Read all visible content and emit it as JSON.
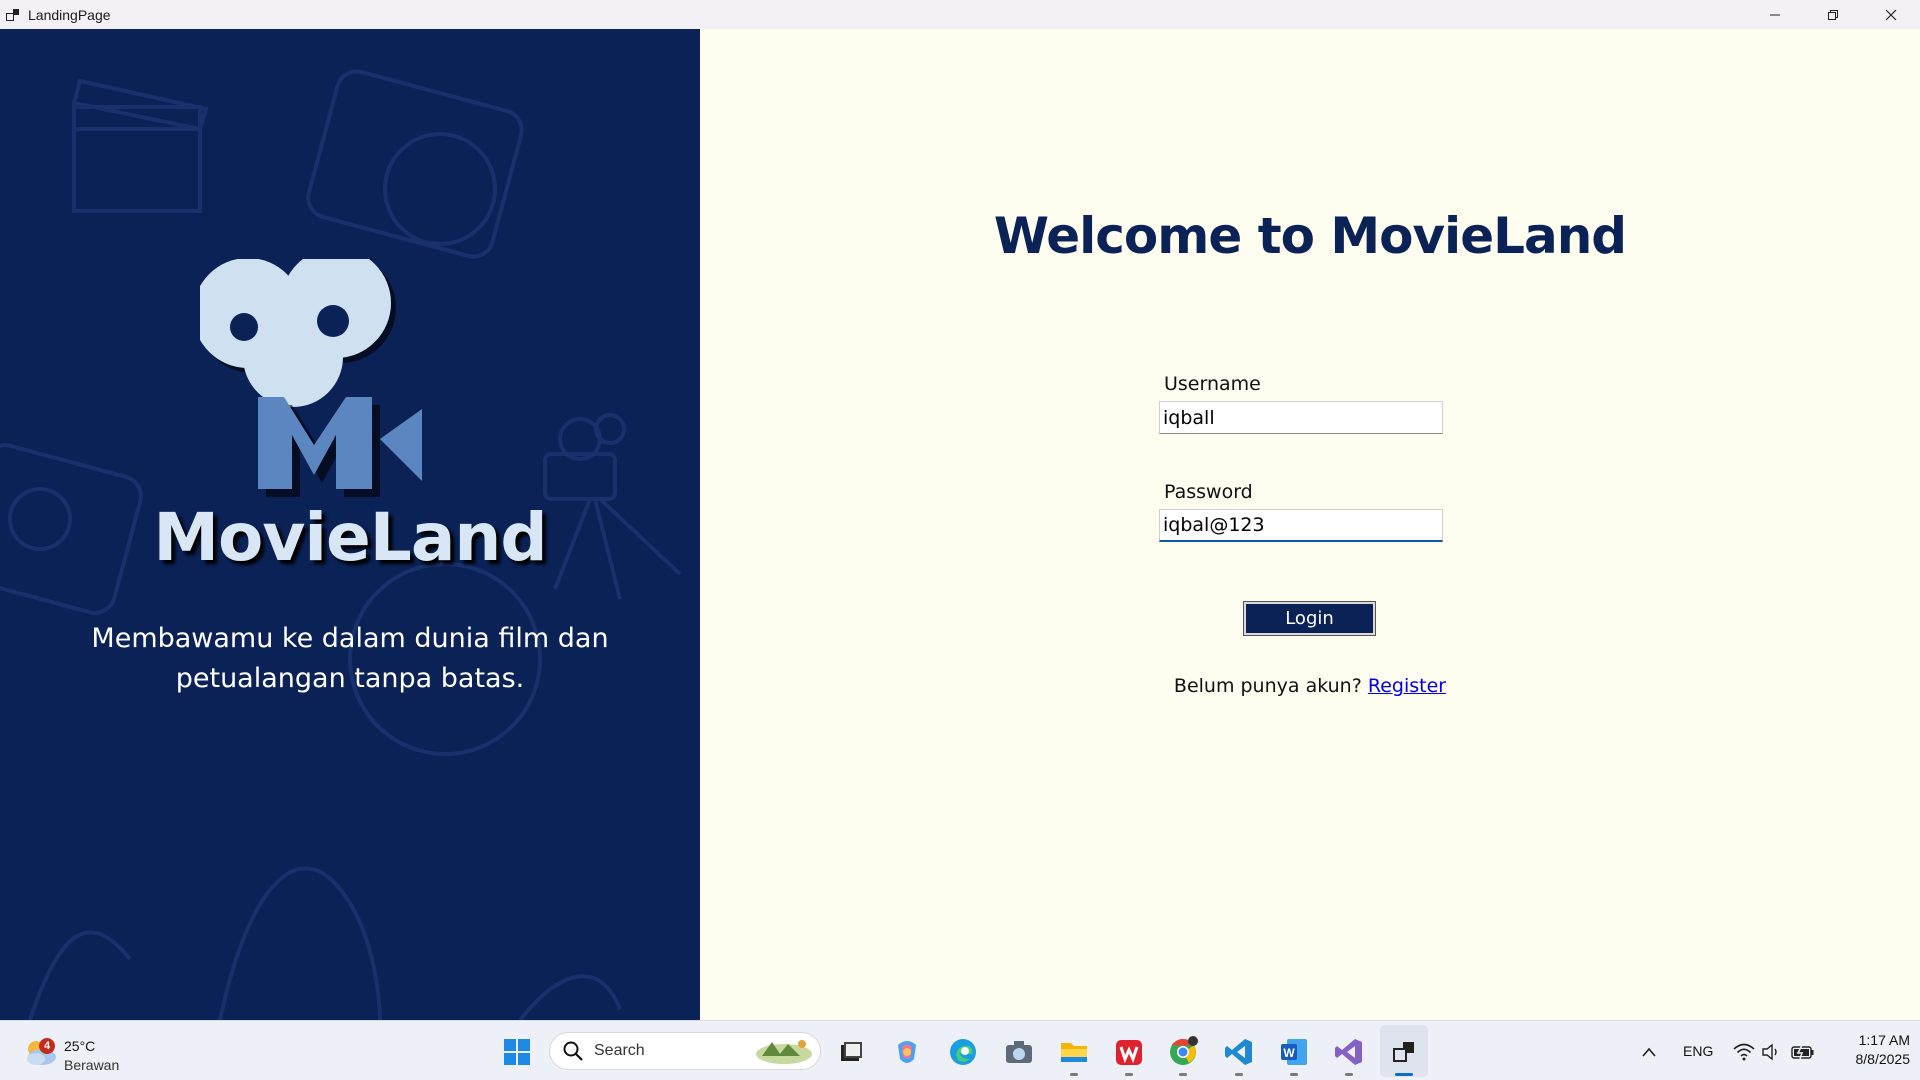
{
  "window": {
    "title": "LandingPage"
  },
  "left": {
    "brand": "MovieLand",
    "tagline_line1": "Membawamu ke dalam dunia film dan",
    "tagline_line2": "petualangan tanpa batas."
  },
  "right": {
    "welcome": "Welcome to MovieLand",
    "username_label": "Username",
    "username_value": "iqball",
    "password_label": "Password",
    "password_value": "iqbal@123",
    "login_label": "Login",
    "register_prompt": "Belum punya akun?",
    "register_link": "Register"
  },
  "taskbar": {
    "weather_badge": "4",
    "weather_temp": "25°C",
    "weather_condition": "Berawan",
    "search_placeholder": "Search",
    "language": "ENG",
    "time": "1:17 AM",
    "date": "8/8/2025"
  },
  "colors": {
    "navy": "#0b2257",
    "cream": "#fffdf0",
    "logo_light": "#cfe0f1",
    "logo_blue": "#5b86c0",
    "link": "#0000ee"
  }
}
